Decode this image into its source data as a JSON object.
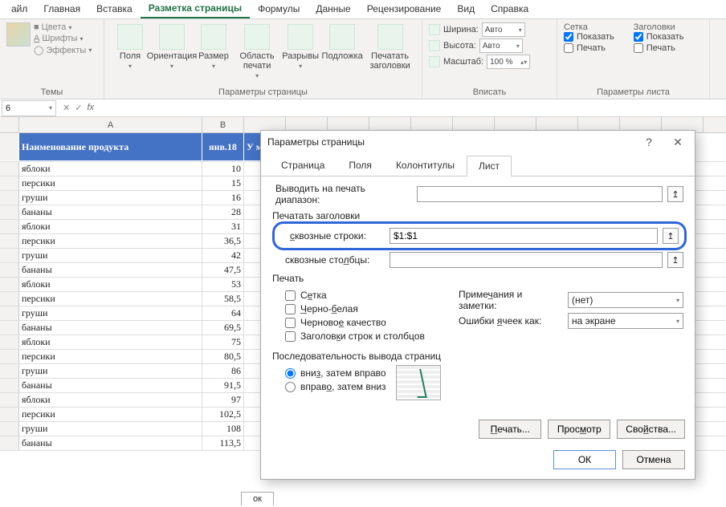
{
  "ribbon_tabs": {
    "file": "айл",
    "home": "Главная",
    "insert": "Вставка",
    "page_layout": "Разметка страницы",
    "formulas": "Формулы",
    "data": "Данные",
    "review": "Рецензирование",
    "view": "Вид",
    "help": "Справка"
  },
  "ribbon": {
    "themes_group": "Темы",
    "themes_colors": "Цвета",
    "themes_fonts": "Шрифты",
    "themes_effects": "Эффекты",
    "page_setup_group": "Параметры страницы",
    "margins": "Поля",
    "orientation": "Ориентация",
    "size": "Размер",
    "print_area": "Область печати",
    "breaks": "Разрывы",
    "background": "Подложка",
    "print_titles": "Печатать заголовки",
    "fit_group": "Вписать",
    "width_lbl": "Ширина:",
    "height_lbl": "Высота:",
    "scale_lbl": "Масштаб:",
    "width_val": "Авто",
    "height_val": "Авто",
    "scale_val": "100 %",
    "sheet_group": "Параметры листа",
    "grid_header": "Сетка",
    "headers_header": "Заголовки",
    "show_lbl": "Показать",
    "print_lbl": "Печать"
  },
  "formula_bar": {
    "name_box": "6",
    "fx": "fx"
  },
  "columns": {
    "A": "A",
    "B": "B"
  },
  "table_header": {
    "A": "Наименование продукта",
    "B": "янв.18",
    "C_partial": "У м"
  },
  "rows": [
    {
      "a": "яблоки",
      "b": "10"
    },
    {
      "a": "персики",
      "b": "15"
    },
    {
      "a": "груши",
      "b": "16"
    },
    {
      "a": "бананы",
      "b": "28"
    },
    {
      "a": "яблоки",
      "b": "31"
    },
    {
      "a": "персики",
      "b": "36,5"
    },
    {
      "a": "груши",
      "b": "42"
    },
    {
      "a": "бананы",
      "b": "47,5"
    },
    {
      "a": "яблоки",
      "b": "53"
    },
    {
      "a": "персики",
      "b": "58,5"
    },
    {
      "a": "груши",
      "b": "64"
    },
    {
      "a": "бананы",
      "b": "69,5"
    },
    {
      "a": "яблоки",
      "b": "75"
    },
    {
      "a": "персики",
      "b": "80,5"
    },
    {
      "a": "груши",
      "b": "86"
    },
    {
      "a": "бананы",
      "b": "91,5"
    },
    {
      "a": "яблоки",
      "b": "97"
    },
    {
      "a": "персики",
      "b": "102,5"
    },
    {
      "a": "груши",
      "b": "108"
    },
    {
      "a": "бананы",
      "b": "113,5"
    }
  ],
  "dialog": {
    "title": "Параметры страницы",
    "tab_page": "Страница",
    "tab_margins": "Поля",
    "tab_headerfooter": "Колонтитулы",
    "tab_sheet": "Лист",
    "print_range_lbl": "Выводить на печать диапазон:",
    "print_range_val": "",
    "print_titles_lbl": "Печатать заголовки",
    "rows_repeat_lbl": "сквозные строки:",
    "rows_repeat_val": "$1:$1",
    "cols_repeat_lbl": "сквозные столбцы:",
    "cols_repeat_val": "",
    "print_section": "Печать",
    "chk_grid": "Сетка",
    "chk_bw": "Черно-белая",
    "chk_draft": "Черновое качество",
    "chk_headings": "Заголовки строк и столбцов",
    "notes_lbl": "Примечания и заметки:",
    "notes_val": "(нет)",
    "errors_lbl": "Ошибки ячеек как:",
    "errors_val": "на экране",
    "order_section": "Последовательность вывода страниц",
    "order_down": "вниз, затем вправо",
    "order_over": "вправо, затем вниз",
    "btn_print": "Печать...",
    "btn_preview": "Просмотр",
    "btn_props": "Свойства...",
    "btn_ok": "ОК",
    "btn_cancel": "Отмена"
  },
  "sheet_tab": "ок"
}
